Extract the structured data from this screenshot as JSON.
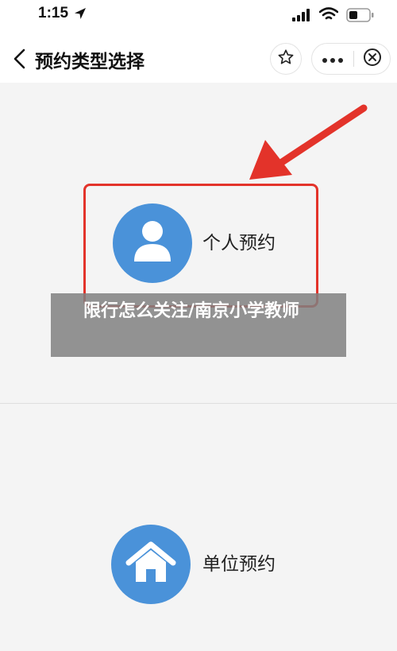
{
  "status_bar": {
    "time": "1:15",
    "icons": [
      "location-arrow-icon",
      "signal-icon",
      "wifi-icon",
      "battery-icon"
    ]
  },
  "navbar": {
    "title": "预约类型选择",
    "icons": [
      "back-chevron-icon",
      "star-icon",
      "more-icon",
      "close-icon"
    ]
  },
  "options": {
    "personal": {
      "label": "个人预约",
      "icon": "person-icon"
    },
    "unit": {
      "label": "单位预约",
      "icon": "home-icon"
    }
  },
  "annotation": {
    "arrow_color": "#e3332a",
    "highlight_color": "#e3332a"
  },
  "overlay": {
    "text": "限行怎么关注/南京小学教师"
  },
  "colors": {
    "accent": "#4a92d9",
    "background": "#f4f4f4"
  }
}
